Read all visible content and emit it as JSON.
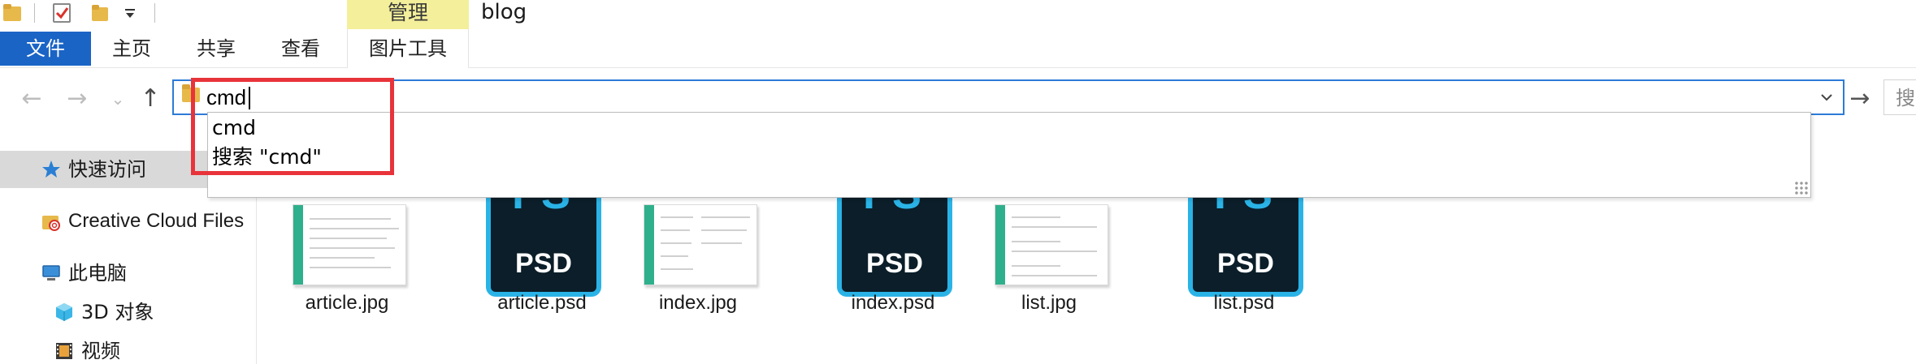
{
  "window": {
    "title": "blog",
    "contextual_tab_group": "管理"
  },
  "quick_access_toolbar": {
    "icons": [
      "folder-icon",
      "properties-checkbox-icon",
      "new-folder-icon",
      "customize-dropdown-icon"
    ]
  },
  "ribbon": {
    "tabs": [
      "文件",
      "主页",
      "共享",
      "查看"
    ],
    "contextual_tab": "图片工具",
    "file_tab_color": "#1a64c6",
    "manage_tab_color": "#f3ef9a"
  },
  "navigation": {
    "back": "←",
    "forward": "→",
    "recent": "⌄",
    "up": "↑",
    "address_value": "cmd",
    "go": "→",
    "search_placeholder": "搜"
  },
  "autocomplete": {
    "items": [
      "cmd",
      "搜索 \"cmd\""
    ],
    "highlight_color": "#e8333a"
  },
  "sidebar": {
    "items": [
      {
        "label": "快速访问",
        "icon": "star-icon",
        "selected": true
      },
      {
        "label": "Creative Cloud Files",
        "icon": "creative-cloud-folder-icon"
      },
      {
        "label": "此电脑",
        "icon": "computer-icon"
      },
      {
        "label": "3D 对象",
        "icon": "3d-objects-icon"
      },
      {
        "label": "视频",
        "icon": "video-icon"
      }
    ]
  },
  "files": [
    {
      "name": "article.jpg",
      "type": "jpg"
    },
    {
      "name": "article.psd",
      "type": "psd"
    },
    {
      "name": "index.jpg",
      "type": "jpg"
    },
    {
      "name": "index.psd",
      "type": "psd"
    },
    {
      "name": "list.jpg",
      "type": "jpg"
    },
    {
      "name": "list.psd",
      "type": "psd"
    }
  ],
  "psd_icon": {
    "top_text": "PS",
    "bottom_text": "PSD",
    "bg": "#0b1e29",
    "accent": "#2ab3e6"
  }
}
